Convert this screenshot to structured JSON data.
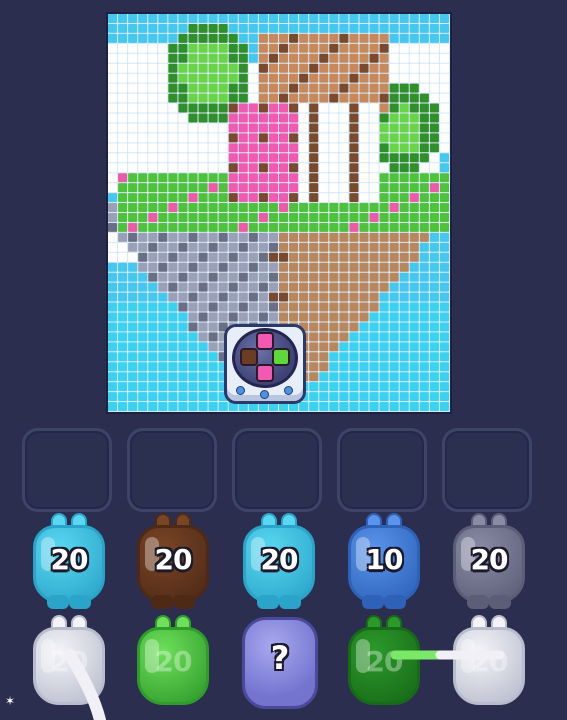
{
  "board": {
    "colors": {
      "sky": "#45c8ef",
      "cloud": "#ffffff",
      "tree_light": "#69d447",
      "tree_dark": "#2f8f2a",
      "roof": "#c7895c",
      "roof_dark": "#7a4a2e",
      "house_pink": "#f25ab2",
      "wall_white": "#ffffff",
      "grass": "#4fc23c",
      "rock": "#9aa0b8",
      "rock_dark": "#6b6f86",
      "dirt": "#b9875d",
      "water": "#3ad2f0",
      "flower": "#ef5aa8"
    }
  },
  "launcher": {
    "icon": "marble-launcher-icon",
    "cube_colors": [
      "#f25ab2",
      "#6b3d23",
      "#5dd93a",
      "#f25ab2"
    ]
  },
  "slots": [
    {},
    {},
    {},
    {},
    {}
  ],
  "pieces_row1": [
    {
      "count": "20",
      "color": "#5ad8f2",
      "dark": "#2aa4c8",
      "icon": "cyan-bunny-icon"
    },
    {
      "count": "20",
      "color": "#7a4526",
      "dark": "#4e2a16",
      "icon": "brown-bunny-icon"
    },
    {
      "count": "20",
      "color": "#5ad8f2",
      "dark": "#2aa4c8",
      "icon": "cyan-bunny-icon"
    },
    {
      "count": "10",
      "color": "#5a94ec",
      "dark": "#2d62b8",
      "icon": "blue-bunny-icon"
    },
    {
      "count": "20",
      "color": "#8a8ca6",
      "dark": "#5c5e78",
      "icon": "gray-bunny-icon"
    }
  ],
  "pieces_row2": [
    {
      "count": "20",
      "color": "#f4f4f8",
      "dark": "#b8bccc",
      "icon": "white-bunny-icon"
    },
    {
      "count": "20",
      "color": "#6ee05a",
      "dark": "#2f9c2c",
      "icon": "green-bunny-icon"
    },
    {
      "count": "?",
      "color": "#8a8ae0",
      "dark": "#4a4a9a",
      "icon": "mystery-bunny-icon"
    },
    {
      "count": "20",
      "color": "#2c9a2a",
      "dark": "#176a18",
      "icon": "dark-green-bunny-icon"
    },
    {
      "count": "20",
      "color": "#f4f4f8",
      "dark": "#b8bccc",
      "icon": "white-bunny-icon"
    }
  ]
}
